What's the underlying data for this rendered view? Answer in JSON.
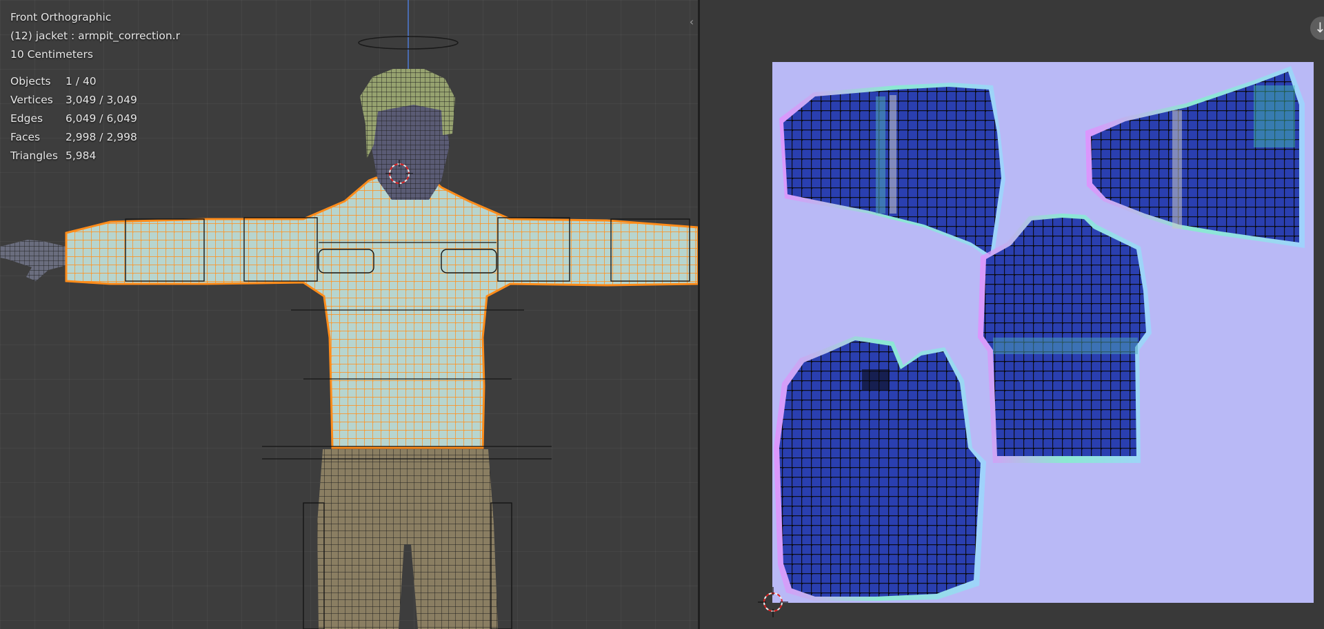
{
  "viewport": {
    "view_name": "Front Orthographic",
    "active_object": "(12) jacket : armpit_correction.r",
    "grid_scale": "10 Centimeters",
    "stats": [
      {
        "label": "Objects",
        "value": "1 / 40"
      },
      {
        "label": "Vertices",
        "value": "3,049 / 3,049"
      },
      {
        "label": "Edges",
        "value": "6,049 / 6,049"
      },
      {
        "label": "Faces",
        "value": "2,998 / 2,998"
      },
      {
        "label": "Triangles",
        "value": "5,984"
      }
    ]
  },
  "icons": {
    "collapse": "chevron-left-icon",
    "navigate": "arrow-down-icon",
    "cursor3d": "3d-cursor-icon",
    "cursor2d": "2d-cursor-icon"
  },
  "colors": {
    "viewport_bg": "#3d3d3d",
    "mesh_selected": "#ff8c1a",
    "jacket_surface": "#b7d5cf",
    "pants_surface": "#8a7e62",
    "hair_surface": "#96a26f",
    "uv_background": "#b9b9f6",
    "uv_island": "#2a3fb0"
  }
}
